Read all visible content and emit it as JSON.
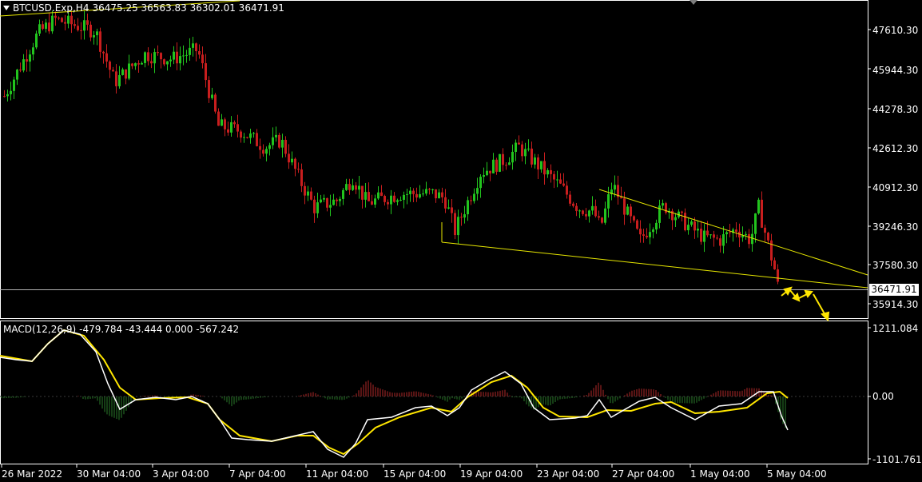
{
  "header": {
    "symbol": "BTCUSD.Exp,H4",
    "ohlc": "36475.25 36563.83 36302.01 36471.91"
  },
  "price_axis": [
    "47610.30",
    "45944.30",
    "44278.30",
    "42612.30",
    "40912.30",
    "39246.30",
    "37580.30",
    "35914.30"
  ],
  "current_price": "36471.91",
  "macd": {
    "title": "MACD(12,26,9)",
    "values": "-479.784 -43.444 0.000 -567.242",
    "axis": [
      "1211.084",
      "0.00",
      "-1101.761"
    ]
  },
  "time_axis": [
    "26 Mar 2022",
    "30 Mar 04:00",
    "3 Apr 04:00",
    "7 Apr 04:00",
    "11 Apr 04:00",
    "15 Apr 04:00",
    "19 Apr 04:00",
    "23 Apr 04:00",
    "27 Apr 04:00",
    "1 May 04:00",
    "5 May 04:00"
  ],
  "colors": {
    "background": "#000000",
    "bull": "#22c41e",
    "bear": "#c81e1e",
    "trendline": "#e6e600",
    "macd_line": "#ffffff",
    "signal_line": "#ffe600",
    "hist_pos": "#b02828",
    "hist_neg": "#2a7a2a"
  },
  "chart_data": {
    "type": "candlestick",
    "ylim": [
      35000,
      48500
    ],
    "close_path": [
      {
        "t": "26 Mar 2022",
        "price": 44500
      },
      {
        "t": "28 Mar",
        "price": 47200
      },
      {
        "t": "29 Mar",
        "price": 47800
      },
      {
        "t": "30 Mar 04:00",
        "price": 47300
      },
      {
        "t": "1 Apr",
        "price": 45100
      },
      {
        "t": "2 Apr",
        "price": 46300
      },
      {
        "t": "3 Apr 04:00",
        "price": 46100
      },
      {
        "t": "4 Apr",
        "price": 46500
      },
      {
        "t": "6 Apr",
        "price": 43200
      },
      {
        "t": "7 Apr 04:00",
        "price": 43000
      },
      {
        "t": "8 Apr",
        "price": 42300
      },
      {
        "t": "9 Apr",
        "price": 42600
      },
      {
        "t": "10 Apr",
        "price": 40800
      },
      {
        "t": "11 Apr 04:00",
        "price": 39700
      },
      {
        "t": "12 Apr",
        "price": 40000
      },
      {
        "t": "13 Apr",
        "price": 41000
      },
      {
        "t": "14 Apr",
        "price": 39900
      },
      {
        "t": "15 Apr 04:00",
        "price": 40300
      },
      {
        "t": "16 Apr",
        "price": 40300
      },
      {
        "t": "17 Apr",
        "price": 40100
      },
      {
        "t": "18 Apr",
        "price": 38700
      },
      {
        "t": "19 Apr 04:00",
        "price": 41200
      },
      {
        "t": "20 Apr",
        "price": 41800
      },
      {
        "t": "21 Apr",
        "price": 42300
      },
      {
        "t": "22 Apr",
        "price": 40600
      },
      {
        "t": "23 Apr 04:00",
        "price": 39700
      },
      {
        "t": "24 Apr",
        "price": 39500
      },
      {
        "t": "25 Apr",
        "price": 38800
      },
      {
        "t": "26 Apr",
        "price": 40700
      },
      {
        "t": "27 Apr 04:00",
        "price": 38300
      },
      {
        "t": "28 Apr",
        "price": 39800
      },
      {
        "t": "29 Apr",
        "price": 38900
      },
      {
        "t": "30 Apr",
        "price": 38400
      },
      {
        "t": "1 May 04:00",
        "price": 38300
      },
      {
        "t": "2 May",
        "price": 38800
      },
      {
        "t": "3 May",
        "price": 38300
      },
      {
        "t": "4 May",
        "price": 39700
      },
      {
        "t": "5 May 04:00",
        "price": 36500
      }
    ]
  }
}
